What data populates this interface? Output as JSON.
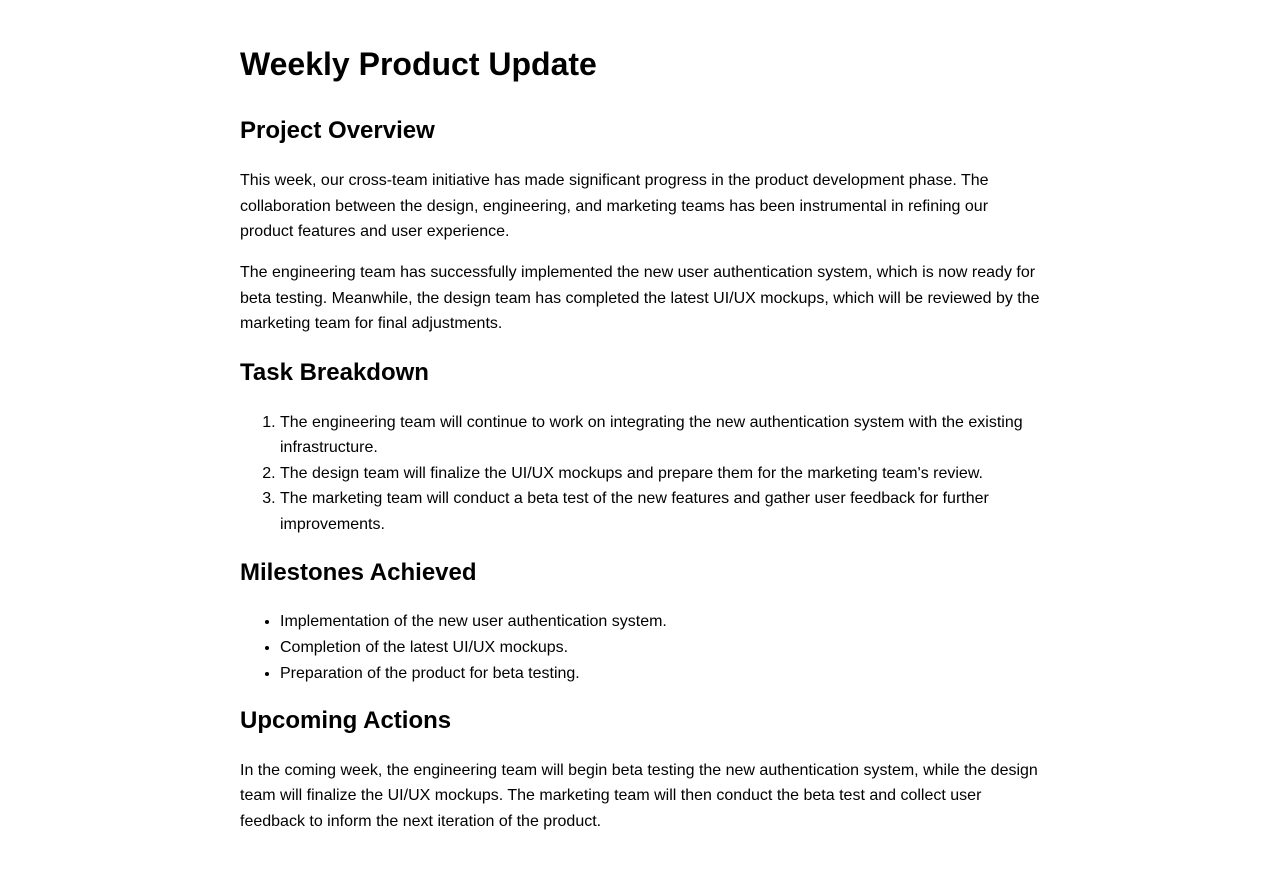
{
  "document": {
    "title": "Weekly Product Update",
    "sections": {
      "overview": {
        "heading": "Project Overview",
        "paragraphs": [
          "This week, our cross-team initiative has made significant progress in the product development phase. The collaboration between the design, engineering, and marketing teams has been instrumental in refining our product features and user experience.",
          "The engineering team has successfully implemented the new user authentication system, which is now ready for beta testing. Meanwhile, the design team has completed the latest UI/UX mockups, which will be reviewed by the marketing team for final adjustments."
        ]
      },
      "tasks": {
        "heading": "Task Breakdown",
        "items": [
          "The engineering team will continue to work on integrating the new authentication system with the existing infrastructure.",
          "The design team will finalize the UI/UX mockups and prepare them for the marketing team's review.",
          "The marketing team will conduct a beta test of the new features and gather user feedback for further improvements."
        ]
      },
      "milestones": {
        "heading": "Milestones Achieved",
        "items": [
          "Implementation of the new user authentication system.",
          "Completion of the latest UI/UX mockups.",
          "Preparation of the product for beta testing."
        ]
      },
      "upcoming": {
        "heading": "Upcoming Actions",
        "paragraphs": [
          "In the coming week, the engineering team will begin beta testing the new authentication system, while the design team will finalize the UI/UX mockups. The marketing team will then conduct the beta test and collect user feedback to inform the next iteration of the product."
        ]
      }
    }
  }
}
